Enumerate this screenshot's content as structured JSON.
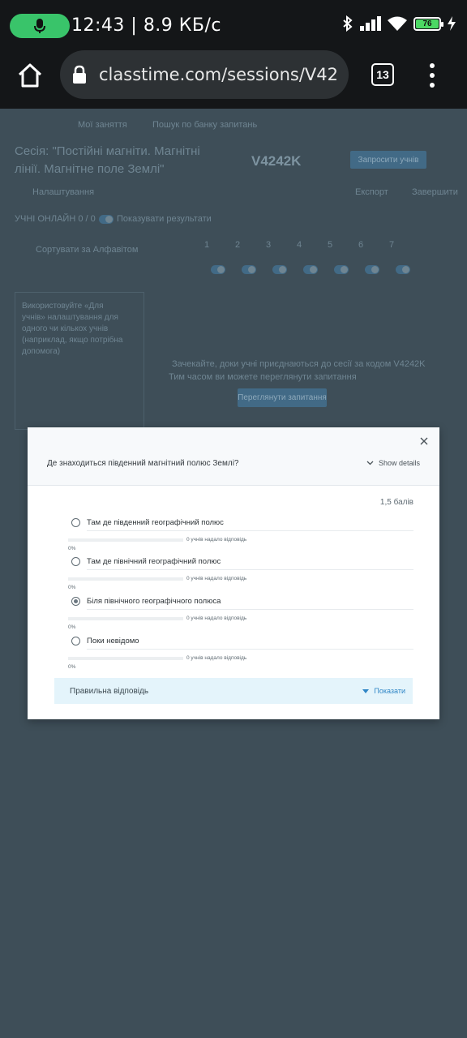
{
  "status_bar": {
    "time": "12:43",
    "speed": "8.9 КБ/с",
    "battery": "76"
  },
  "browser": {
    "url": "classtime.com/sessions/V4242K",
    "tab_count": "13"
  },
  "background_page": {
    "nav_items": [
      "Мої заняття",
      "Пошук по банку запитань"
    ],
    "session_title": "Сесія: \"Постійні магніти. Магнітні лінії. Магнітне поле Землі\"",
    "session_code": "V4242K",
    "settings_label": "Налаштування",
    "invite_button": "Запросити учнів",
    "export_label": "Експорт",
    "close_label": "Завершити",
    "students_count": "УЧНІ ОНЛАЙН 0 / 0",
    "reveal_toggle_label": "Показувати результати",
    "sort_label": "Сортувати за Алфавітом",
    "hint_text": "Використовуйте «Для учнів» налаштування для одного чи кількох учнів (наприклад, якщо потрібна допомога)",
    "empty_text_1": "Зачекайте, доки учні приєднаються до сесії за кодом V4242K",
    "empty_text_2": "Тим часом ви можете переглянути запитання",
    "empty_button": "Переглянути запитання",
    "question_numbers": [
      "1",
      "2",
      "3",
      "4",
      "5",
      "6",
      "7"
    ]
  },
  "modal": {
    "question": "Де знаходиться південний магнітний полюс Землі?",
    "show_details": "Show details",
    "points": "1,5 балів",
    "options": [
      {
        "label": "Там де південний географічний полюс",
        "responses": "0 учнів надало відповідь",
        "percent": "0%",
        "selected": false
      },
      {
        "label": "Там де північний географічний полюс",
        "responses": "0 учнів надало відповідь",
        "percent": "0%",
        "selected": false
      },
      {
        "label": "Біля північного географічного полюса",
        "responses": "0 учнів надало відповідь",
        "percent": "0%",
        "selected": true
      },
      {
        "label": "Поки невідомо",
        "responses": "0 учнів надало відповідь",
        "percent": "0%",
        "selected": false
      }
    ],
    "correct_answer_label": "Правильна відповідь",
    "show_button": "Показати"
  },
  "colors": {
    "overlay": "#3e4e58",
    "accent_blue": "#2f86c6",
    "answer_panel": "#e4f4fb",
    "mic_green": "#39c46a"
  }
}
